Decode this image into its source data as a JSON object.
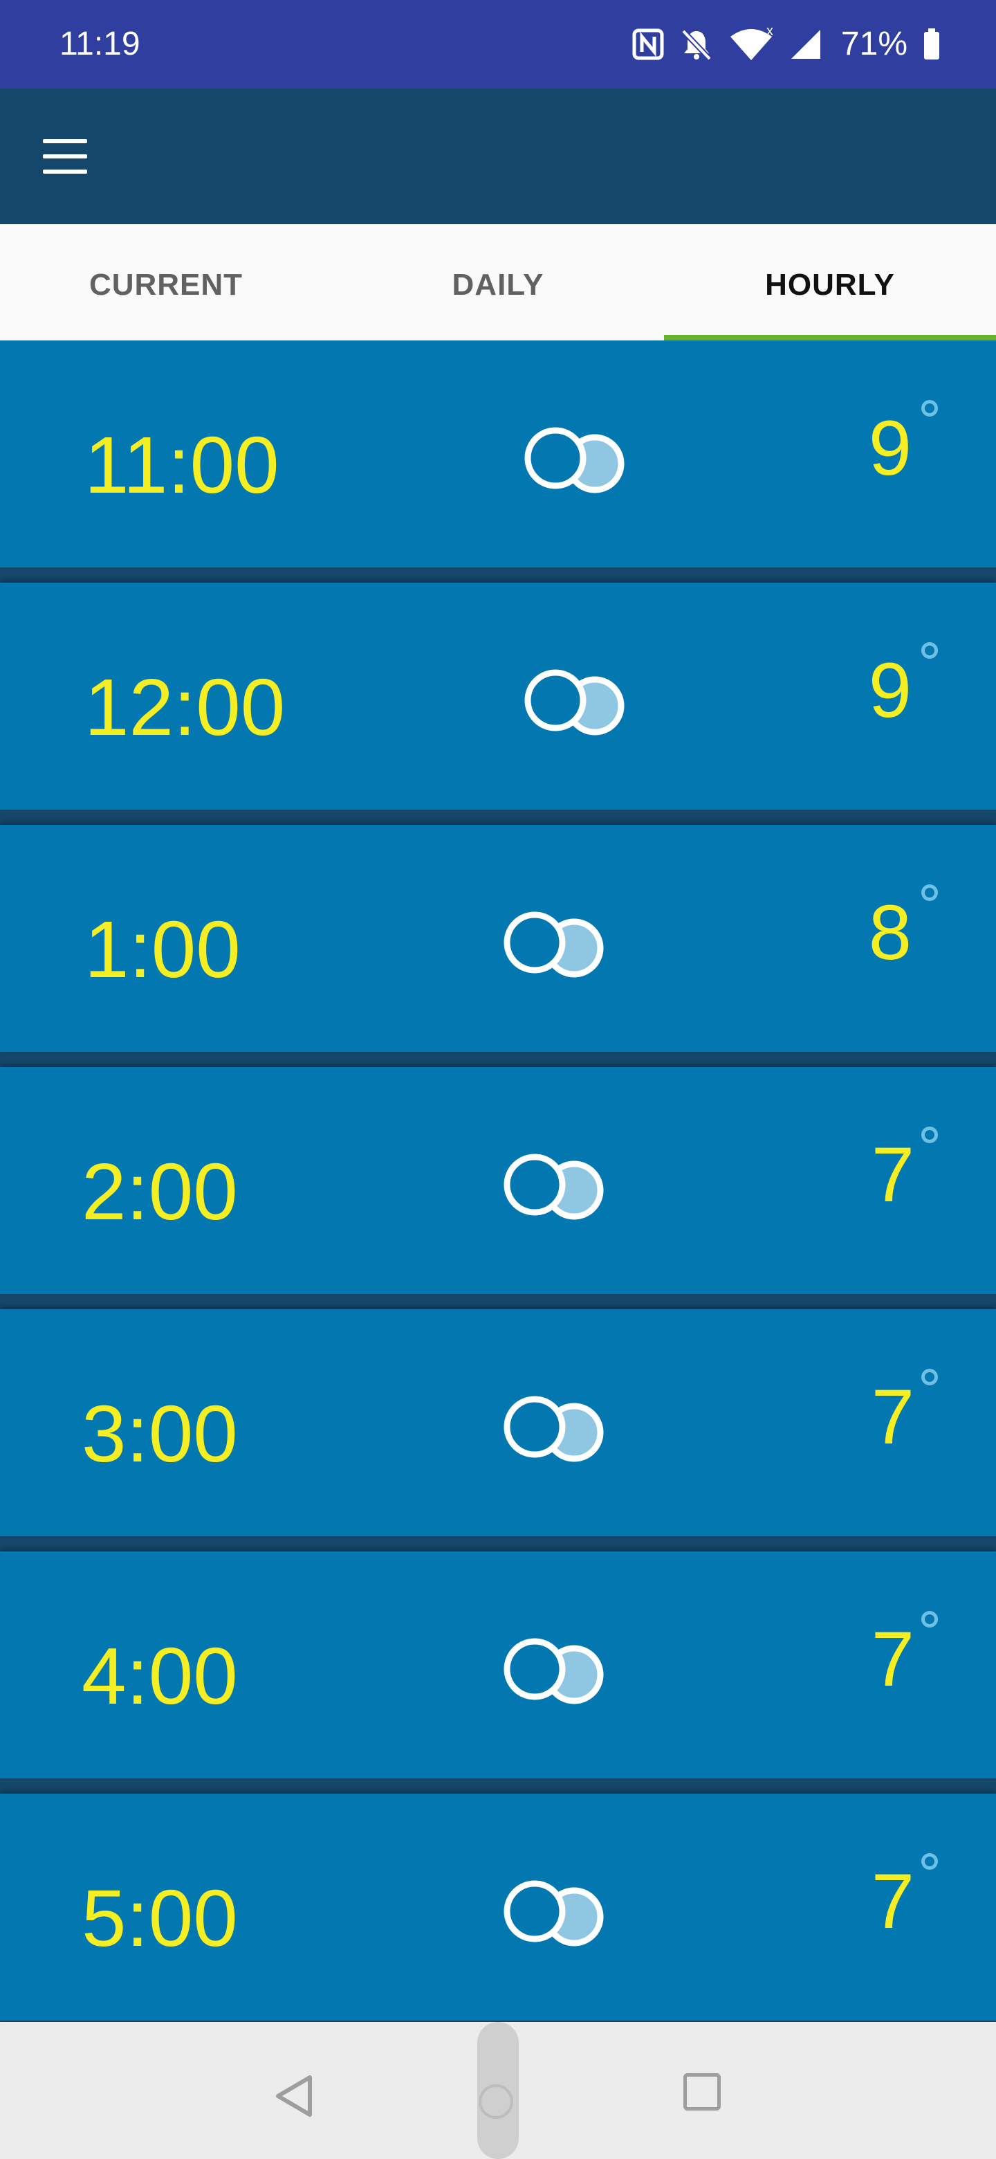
{
  "status_bar": {
    "time": "11:19",
    "battery": "71%",
    "icons": [
      "nfc-icon",
      "bell-off-icon",
      "wifi-icon",
      "signal-icon",
      "battery-icon"
    ]
  },
  "app_bar": {
    "menu_icon": "hamburger-menu-icon"
  },
  "tabs": [
    {
      "label": "CURRENT",
      "active": false
    },
    {
      "label": "DAILY",
      "active": false
    },
    {
      "label": "HOURLY",
      "active": true
    }
  ],
  "hourly": [
    {
      "time": "11:00",
      "icon": "cloudy-icon",
      "temp": "9"
    },
    {
      "time": "12:00",
      "icon": "cloudy-icon",
      "temp": "9"
    },
    {
      "time": "1:00",
      "icon": "cloudy-icon",
      "temp": "8"
    },
    {
      "time": "2:00",
      "icon": "cloudy-icon",
      "temp": "7"
    },
    {
      "time": "3:00",
      "icon": "cloudy-icon",
      "temp": "7"
    },
    {
      "time": "4:00",
      "icon": "cloudy-icon",
      "temp": "7"
    },
    {
      "time": "5:00",
      "icon": "cloudy-icon",
      "temp": "7"
    }
  ],
  "colors": {
    "status_bar": "#303f9f",
    "app_bar": "#15476a",
    "row_bg": "#0377b0",
    "text_yellow": "#f4ee22",
    "tab_indicator": "#6ab42d"
  }
}
